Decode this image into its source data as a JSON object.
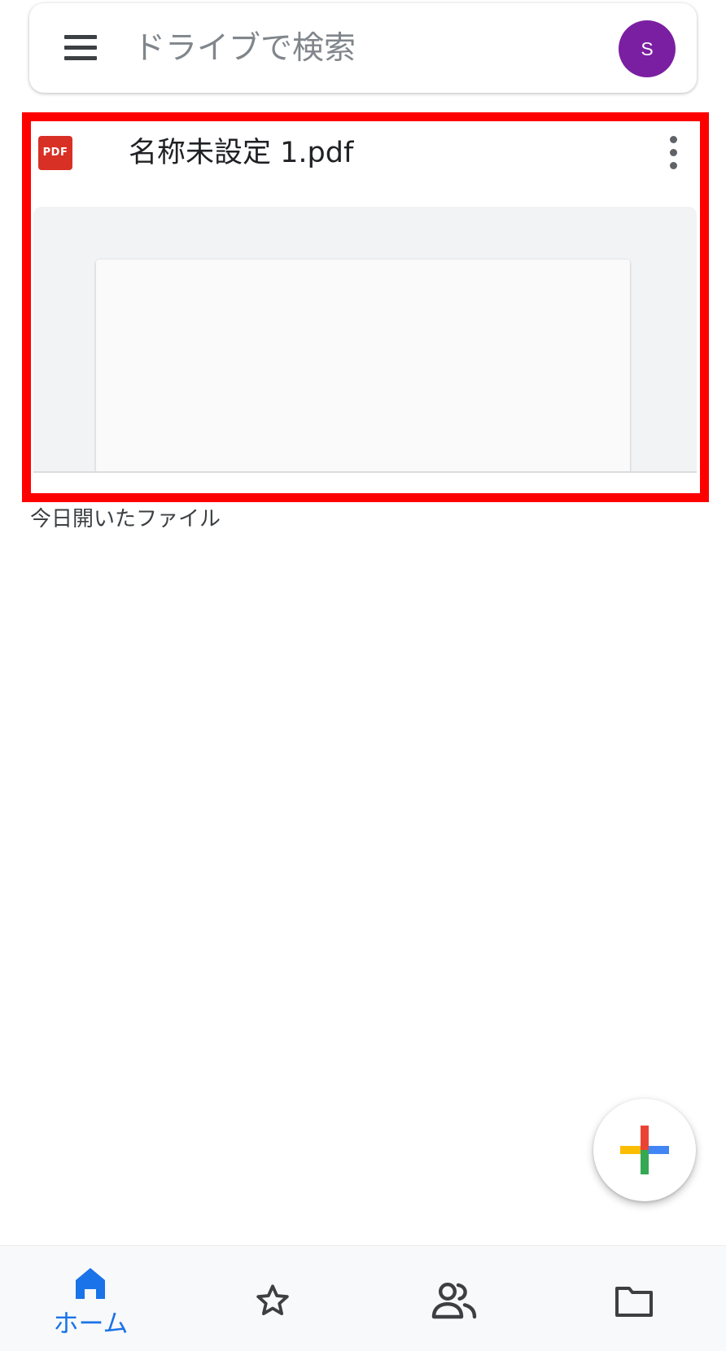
{
  "search": {
    "placeholder": "ドライブで検索"
  },
  "account": {
    "avatar_initial": "S",
    "avatar_color": "#7b1fa2"
  },
  "file_card": {
    "name": "名称未設定 1.pdf",
    "type_badge": "PDF",
    "type_icon": "pdf-icon",
    "badge_color": "#d93025",
    "highlight_color": "#ff0000"
  },
  "opened_label": "今日開いたファイル",
  "fab": {
    "icon": "plus-icon"
  },
  "bottom_nav": {
    "active_color": "#1a73e8",
    "items": [
      {
        "icon": "home-icon",
        "label": "ホーム",
        "active": true
      },
      {
        "icon": "star-icon",
        "active": false
      },
      {
        "icon": "shared-people-icon",
        "active": false
      },
      {
        "icon": "folder-icon",
        "active": false
      }
    ]
  }
}
